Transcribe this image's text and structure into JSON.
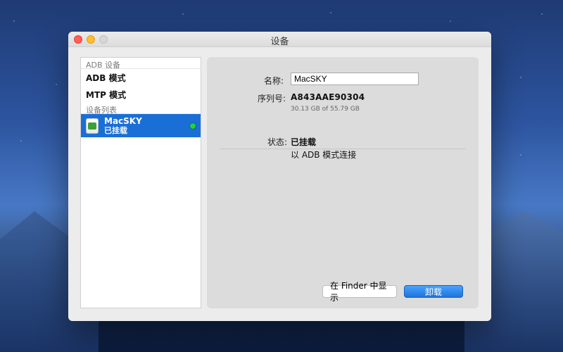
{
  "window": {
    "title": "设备",
    "traffic_lights": {
      "red": "#ff5f57",
      "yellow": "#ffbd2e",
      "green_disabled": "#d7d7d7"
    }
  },
  "sidebar": {
    "sections": {
      "adb_devices": "ADB 设备",
      "device_list": "设备列表"
    },
    "menu_items": [
      {
        "label": "ADB 模式"
      },
      {
        "label": "MTP 模式"
      }
    ],
    "devices": [
      {
        "name": "MacSKY",
        "status": "已挂载",
        "online_color": "#23d13a",
        "selected_color": "#1a6fd6",
        "icon": "android-device-icon"
      }
    ]
  },
  "details": {
    "name_label": "名称:",
    "name_value": "MacSKY",
    "serial_label": "序列号:",
    "serial_value": "A843AAE90304",
    "storage_text": "30.13 GB of 55.79 GB",
    "status_label": "状态:",
    "status_value": "已挂载",
    "status_detail": "以 ADB 模式连接"
  },
  "buttons": {
    "show_in_finder": "在 Finder 中显示",
    "unmount": "卸载"
  }
}
